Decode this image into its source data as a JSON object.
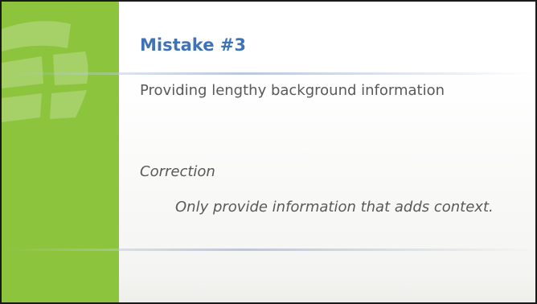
{
  "slide": {
    "title": "Mistake #3",
    "subtitle": "Providing lengthy background information",
    "correction_label": "Correction",
    "correction_text": "Only provide information that adds context."
  },
  "colors": {
    "left_bar": "#8cc43e",
    "title": "#3f73b8",
    "body_text": "#595959",
    "rule": "#b9c8dc"
  },
  "decor": {
    "left_bar_graphic": "globe-segments-icon"
  }
}
